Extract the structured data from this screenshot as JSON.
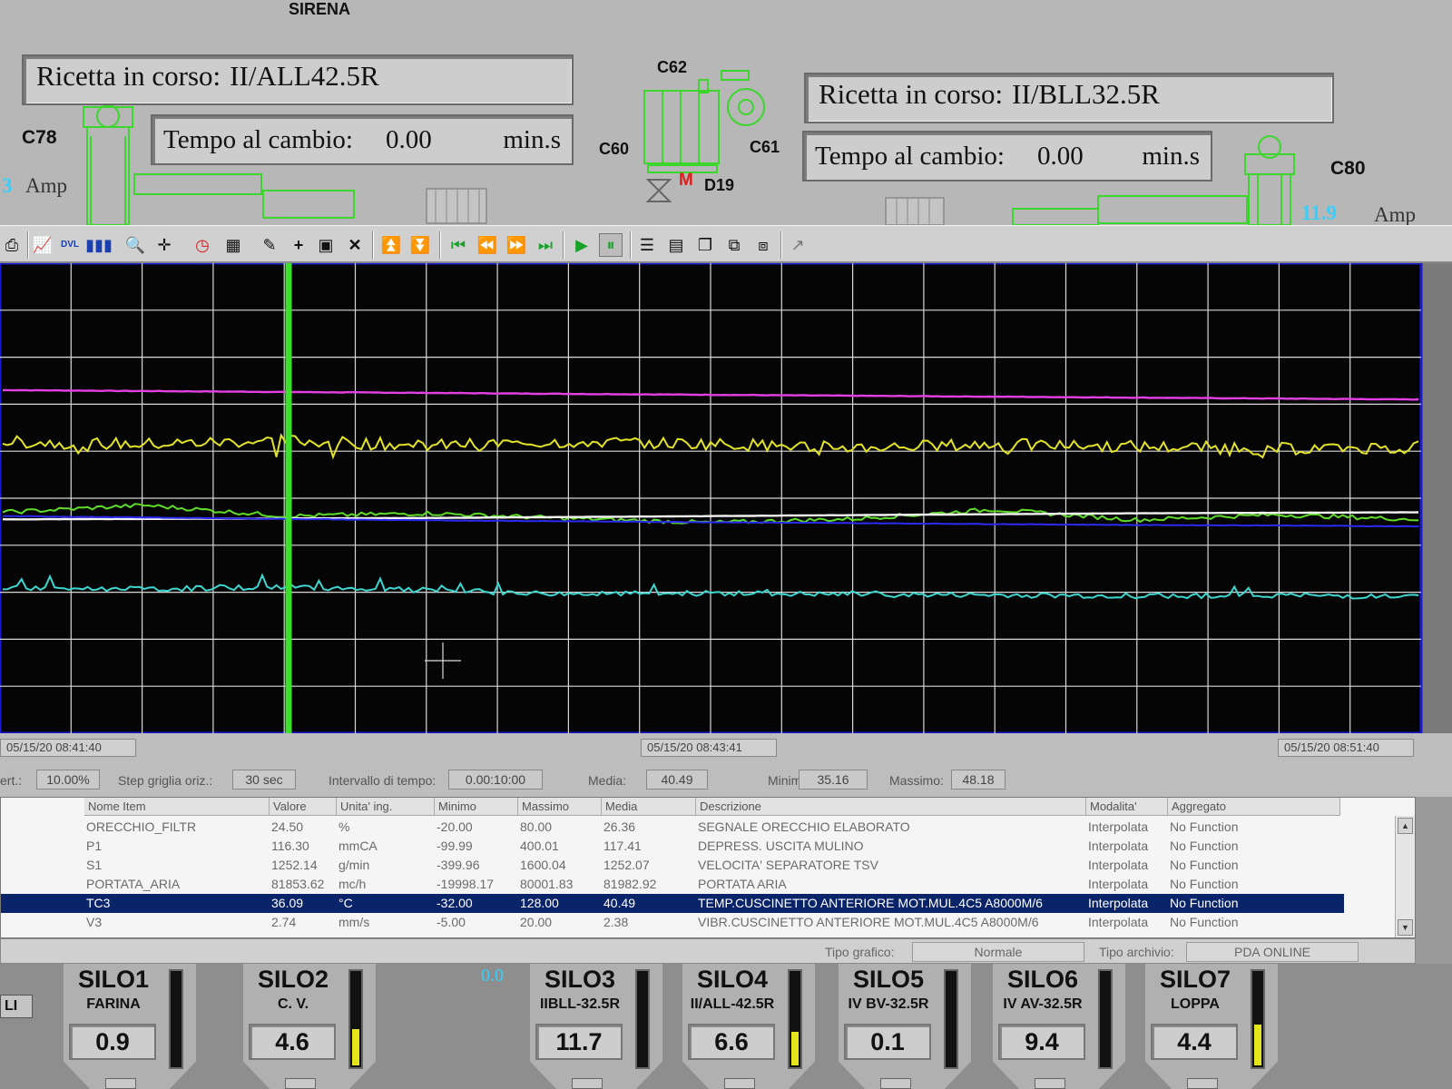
{
  "header": {
    "siren_label": "SIRENA",
    "left": {
      "recipe_label": "Ricetta in corso:",
      "recipe_value": "II/ALL42.5R",
      "timer_label": "Tempo al cambio:",
      "timer_value": "0.00",
      "timer_unit": "min.s",
      "mill_tag": "C78",
      "amp_value": "3",
      "amp_unit": "Amp"
    },
    "right": {
      "recipe_label": "Ricetta in corso:",
      "recipe_value": "II/BLL32.5R",
      "timer_label": "Tempo al cambio:",
      "timer_value": "0.00",
      "timer_unit": "min.s",
      "mill_tag": "C80",
      "amp_value": "11.9",
      "amp_unit": "Amp"
    },
    "center_tags": {
      "c62": "C62",
      "c60": "C60",
      "c61": "C61",
      "d19": "D19",
      "motor_badge": "M"
    }
  },
  "toolbar": {
    "icons": [
      "print-icon",
      "line-chart-icon",
      "dvl-icon",
      "bar-chart-icon",
      "zoom-icon",
      "crosshair-icon",
      "clock-icon",
      "export-icon",
      "wand-icon",
      "add-icon",
      "edit-icon",
      "delete-icon",
      "move-up-icon",
      "move-down-icon",
      "first-icon",
      "rewind-icon",
      "forward-icon",
      "last-icon",
      "play-icon",
      "pause-icon",
      "list-icon",
      "table-icon",
      "copy-icon",
      "link-icon",
      "layers-icon",
      "cursor-icon"
    ]
  },
  "chart_data": {
    "type": "line",
    "series": [
      {
        "color": "#e33fe3",
        "values": [
          73,
          72.8,
          72.6,
          72.4,
          72.2,
          72.0,
          71.8,
          71.6,
          71.4,
          71.2,
          71.0
        ]
      },
      {
        "color": "#e3e32a",
        "values": [
          62,
          61.5,
          62.3,
          61.2,
          62.0,
          61.6,
          60.8,
          61.4,
          61.0,
          60.5,
          60.9
        ]
      },
      {
        "color": "#5fdc2a",
        "values": [
          47,
          48.5,
          46.2,
          46.8,
          45.7,
          44.8,
          45.6,
          47.6,
          45.4,
          46.5,
          45.5
        ]
      },
      {
        "color": "#f2f2f2",
        "values": [
          45.5,
          45.6,
          45.7,
          45.8,
          46.0,
          46.2,
          46.4,
          46.6,
          46.8,
          46.9,
          47.0
        ]
      },
      {
        "color": "#2a2af0",
        "values": [
          46.2,
          45.9,
          45.6,
          45.3,
          45.1,
          44.9,
          44.7,
          44.5,
          44.3,
          44.2,
          44.0
        ]
      },
      {
        "color": "#3fd6cf",
        "values": [
          31,
          30.6,
          31.2,
          30.4,
          29.6,
          29.8,
          29.5,
          29.4,
          29.2,
          29.4,
          29.0
        ]
      }
    ],
    "grid": true
  },
  "time_strip": {
    "start": "05/15/20 08:41:40",
    "cursor": "05/15/20 08:43:41",
    "end": "05/15/20 08:51:40",
    "vert_label": "ert.:",
    "vert_value": "10.00%",
    "step_label": "Step griglia oriz.:",
    "step_value": "30 sec",
    "interval_label": "Intervallo di tempo:",
    "interval_value": "0.00:10:00",
    "mean_label": "Media:",
    "mean_value": "40.49",
    "min_label": "Minimo:",
    "min_value": "35.16",
    "max_label": "Massimo:",
    "max_value": "48.18"
  },
  "table": {
    "columns": [
      "Nome Item",
      "Valore",
      "Unita' ing.",
      "Minimo",
      "Massimo",
      "Media",
      "Descrizione",
      "Modalita'",
      "Aggregato"
    ],
    "rows": [
      [
        "ORECCHIO_FILTR",
        "24.50",
        "%",
        "-20.00",
        "80.00",
        "26.36",
        "SEGNALE ORECCHIO ELABORATO",
        "Interpolata",
        "No Function"
      ],
      [
        "P1",
        "116.30",
        "mmCA",
        "-99.99",
        "400.01",
        "117.41",
        "DEPRESS. USCITA MULINO",
        "Interpolata",
        "No Function"
      ],
      [
        "S1",
        "1252.14",
        "g/min",
        "-399.96",
        "1600.04",
        "1252.07",
        "VELOCITA' SEPARATORE TSV",
        "Interpolata",
        "No Function"
      ],
      [
        "PORTATA_ARIA",
        "81853.62",
        "mc/h",
        "-19998.17",
        "80001.83",
        "81982.92",
        "PORTATA ARIA",
        "Interpolata",
        "No Function"
      ],
      [
        "TC3",
        "36.09",
        "°C",
        "-32.00",
        "128.00",
        "40.49",
        "TEMP.CUSCINETTO ANTERIORE MOT.MUL.4C5 A8000M/6",
        "Interpolata",
        "No Function"
      ],
      [
        "V3",
        "2.74",
        "mm/s",
        "-5.00",
        "20.00",
        "2.38",
        "VIBR.CUSCINETTO ANTERIORE MOT.MUL.4C5 A8000M/6",
        "Interpolata",
        "No Function"
      ]
    ],
    "selected_row": 4
  },
  "footer": {
    "chart_type_label": "Tipo grafico:",
    "chart_type_value": "Normale",
    "archive_type_label": "Tipo archivio:",
    "archive_type_value": "PDA ONLINE"
  },
  "silos": {
    "side_label": "LI",
    "zero_value": "0.0",
    "items": [
      {
        "name": "SILO1",
        "material": "FARINA",
        "level": "0.9",
        "fill": 0.0
      },
      {
        "name": "SILO2",
        "material": "C. V.",
        "level": "4.6",
        "fill": 0.38
      },
      {
        "name": "SILO3",
        "material": "IIBLL-32.5R",
        "level": "11.7",
        "fill": 0.0
      },
      {
        "name": "SILO4",
        "material": "II/ALL-42.5R",
        "level": "6.6",
        "fill": 0.35
      },
      {
        "name": "SILO5",
        "material": "IV BV-32.5R",
        "level": "0.1",
        "fill": 0.0
      },
      {
        "name": "SILO6",
        "material": "IV AV-32.5R",
        "level": "9.4",
        "fill": 0.0
      },
      {
        "name": "SILO7",
        "material": "LOPPA",
        "level": "4.4",
        "fill": 0.42
      }
    ]
  }
}
